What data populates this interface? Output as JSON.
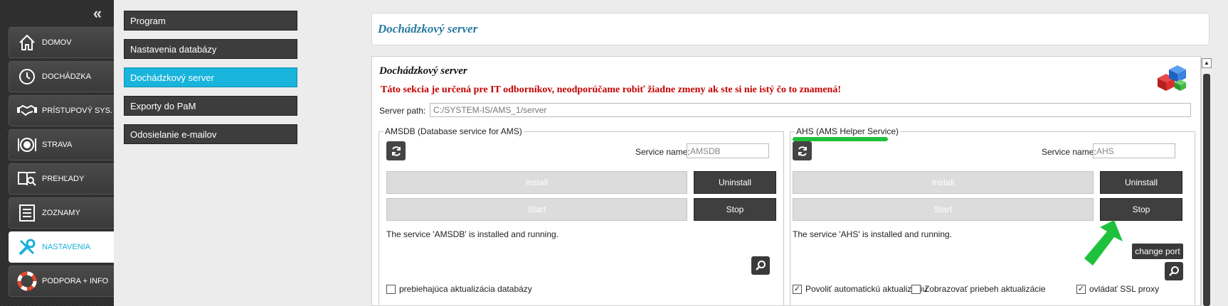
{
  "sidebar": {
    "collapse_icon": "chevron-double-left-icon",
    "items": [
      {
        "label": "DOMOV",
        "icon": "house-icon"
      },
      {
        "label": "DOCHÁDZKA",
        "icon": "clock-icon"
      },
      {
        "label": "PRÍSTUPOVÝ SYS.",
        "icon": "handshake-icon"
      },
      {
        "label": "STRAVA",
        "icon": "plate-icon"
      },
      {
        "label": "PREHĽADY",
        "icon": "book-search-icon"
      },
      {
        "label": "ZOZNAMY",
        "icon": "list-icon"
      },
      {
        "label": "NASTAVENIA",
        "icon": "tools-icon",
        "active": true
      },
      {
        "label": "PODPORA + INFO",
        "icon": "lifebuoy-icon"
      }
    ]
  },
  "submenu": {
    "items": [
      {
        "label": "Program"
      },
      {
        "label": "Nastavenia databázy"
      },
      {
        "label": "Dochádzkový server",
        "active": true
      },
      {
        "label": "Exporty do PaM"
      },
      {
        "label": "Odosielanie e-mailov"
      }
    ]
  },
  "main": {
    "title": "Dochádzkový server",
    "section_heading": "Dochádzkový server",
    "warning": "Táto sekcia je určená pre IT odborníkov, neodporúčame robiť žiadne zmeny ak ste si nie istý čo to znamená!",
    "server_path_label": "Server path:",
    "server_path_value": "C:/SYSTEM-IS/AMS_1/server"
  },
  "amsdb": {
    "legend": "AMSDB (Database service for AMS)",
    "service_name_label": "Service name:",
    "service_name_value": "AMSDB",
    "install": "Install",
    "uninstall": "Uninstall",
    "start": "Start",
    "stop": "Stop",
    "status": "The service 'AMSDB' is installed and running.",
    "checkbox_update": "prebiehajúca aktualizácia databázy"
  },
  "ahs": {
    "legend": "AHS (AMS Helper Service)",
    "service_name_label": "Service name:",
    "service_name_value": "AHS",
    "install": "Install",
    "uninstall": "Uninstall",
    "start": "Start",
    "stop": "Stop",
    "status": "The service 'AHS' is installed and running.",
    "change_port": "change port",
    "checkbox_auto_update": "Povoliť automatickú aktualizáciu",
    "checkbox_show_progress": "Zobrazovať priebeh aktualizácie",
    "checkbox_ssl_proxy": "ovládať SSL proxy"
  },
  "colors": {
    "accent": "#18b4dc",
    "warning": "#c40000",
    "annotation": "#1ec13b"
  }
}
